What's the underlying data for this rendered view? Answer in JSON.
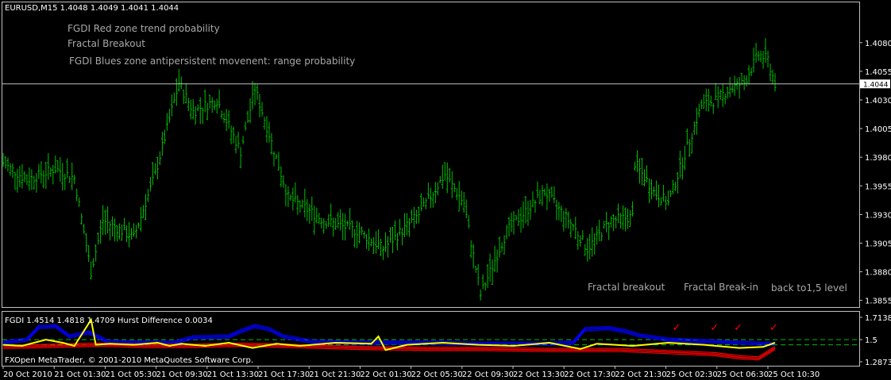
{
  "symbol_header": "EURUSD,M15  1.4048 1.4049 1.4041 1.4044",
  "annotations_top": [
    "FGDI Red zone trend probability",
    "Fractal Breakout",
    "FGDI Blues zone antipersistent movenent: range probability"
  ],
  "annotations_bottom": [
    "Fractal breakout",
    "Fractal Break-in",
    "back to1,5 level"
  ],
  "current_price": "1.4044",
  "indicator_header": "FGDI 1.4514 1.4818 1.4709  Hurst Difference 0.0034",
  "copyright": "FXOpen MetaTrader, © 2001-2010 MetaQuotes Software Corp.",
  "check_mark": "✓",
  "colors": {
    "background": "#000000",
    "bars": "#00c000",
    "frame": "#c0c0c0",
    "fgdi_blue": "#0000ff",
    "fgdi_red": "#ff0000",
    "fgdi_yellow": "#ffff00",
    "level_line": "#00c000",
    "check": "#ff0000"
  },
  "chart_data": [
    {
      "type": "ohlc",
      "title": "EURUSD,M15",
      "ylim": [
        1.3852,
        1.4102
      ],
      "y_ticks": [
        "1.4080",
        "1.4055",
        "1.4030",
        "1.4005",
        "1.3980",
        "1.3955",
        "1.3930",
        "1.3905",
        "1.3880",
        "1.3855"
      ],
      "x_ticks": [
        "20 Oct 2010",
        "21 Oct 01:30",
        "21 Oct 05:30",
        "21 Oct 09:30",
        "21 Oct 13:30",
        "21 Oct 17:30",
        "21 Oct 21:30",
        "22 Oct 01:30",
        "22 Oct 05:30",
        "22 Oct 09:30",
        "22 Oct 13:30",
        "22 Oct 17:30",
        "22 Oct 21:30",
        "25 Oct 02:30",
        "25 Oct 06:30",
        "25 Oct 10:30"
      ],
      "key_points": [
        {
          "bar": 0,
          "price": 1.3975
        },
        {
          "bar": 10,
          "price": 1.396
        },
        {
          "bar": 22,
          "price": 1.397
        },
        {
          "bar": 30,
          "price": 1.3962
        },
        {
          "bar": 37,
          "price": 1.388
        },
        {
          "bar": 42,
          "price": 1.3925
        },
        {
          "bar": 55,
          "price": 1.391
        },
        {
          "bar": 64,
          "price": 1.3965
        },
        {
          "bar": 74,
          "price": 1.4045
        },
        {
          "bar": 80,
          "price": 1.402
        },
        {
          "bar": 90,
          "price": 1.403
        },
        {
          "bar": 100,
          "price": 1.3985
        },
        {
          "bar": 106,
          "price": 1.404
        },
        {
          "bar": 112,
          "price": 1.4
        },
        {
          "bar": 120,
          "price": 1.3945
        },
        {
          "bar": 135,
          "price": 1.3925
        },
        {
          "bar": 150,
          "price": 1.3915
        },
        {
          "bar": 160,
          "price": 1.39
        },
        {
          "bar": 175,
          "price": 1.393
        },
        {
          "bar": 186,
          "price": 1.3965
        },
        {
          "bar": 194,
          "price": 1.394
        },
        {
          "bar": 201,
          "price": 1.386
        },
        {
          "bar": 212,
          "price": 1.3915
        },
        {
          "bar": 228,
          "price": 1.395
        },
        {
          "bar": 240,
          "price": 1.392
        },
        {
          "bar": 246,
          "price": 1.39
        },
        {
          "bar": 256,
          "price": 1.3925
        },
        {
          "bar": 265,
          "price": 1.3928
        },
        {
          "bar": 266,
          "price": 1.3975
        },
        {
          "bar": 274,
          "price": 1.395
        },
        {
          "bar": 280,
          "price": 1.394
        },
        {
          "bar": 294,
          "price": 1.4025
        },
        {
          "bar": 300,
          "price": 1.403
        },
        {
          "bar": 306,
          "price": 1.404
        },
        {
          "bar": 312,
          "price": 1.4045
        },
        {
          "bar": 318,
          "price": 1.407
        },
        {
          "bar": 322,
          "price": 1.4065
        },
        {
          "bar": 325,
          "price": 1.4044
        }
      ]
    },
    {
      "type": "line",
      "title": "FGDI 1.4514 1.4818 1.4709  Hurst Difference 0.0034",
      "ylim": [
        1.2873,
        1.7138
      ],
      "y_ticks": [
        "1.7138",
        "1.5",
        "1.2873"
      ],
      "levels": [
        1.5,
        1.45
      ],
      "series": [
        {
          "name": "FGDI 1.4514",
          "color": "#0000ff",
          "points": [
            [
              0,
              1.47
            ],
            [
              10,
              1.5
            ],
            [
              15,
              1.62
            ],
            [
              22,
              1.63
            ],
            [
              28,
              1.53
            ],
            [
              36,
              1.57
            ],
            [
              44,
              1.48
            ],
            [
              60,
              1.47
            ],
            [
              72,
              1.47
            ],
            [
              80,
              1.52
            ],
            [
              95,
              1.53
            ],
            [
              100,
              1.58
            ],
            [
              106,
              1.63
            ],
            [
              112,
              1.6
            ],
            [
              118,
              1.53
            ],
            [
              130,
              1.48
            ],
            [
              150,
              1.47
            ],
            [
              180,
              1.47
            ],
            [
              200,
              1.46
            ],
            [
              230,
              1.46
            ],
            [
              240,
              1.47
            ],
            [
              245,
              1.6
            ],
            [
              255,
              1.61
            ],
            [
              262,
              1.58
            ],
            [
              268,
              1.54
            ],
            [
              280,
              1.5
            ],
            [
              300,
              1.48
            ],
            [
              320,
              1.46
            ],
            [
              325,
              1.46
            ]
          ]
        },
        {
          "name": "FGDI 1.4818",
          "color": "#ff0000",
          "points": [
            [
              0,
              1.43
            ],
            [
              20,
              1.44
            ],
            [
              40,
              1.45
            ],
            [
              60,
              1.44
            ],
            [
              80,
              1.44
            ],
            [
              100,
              1.45
            ],
            [
              120,
              1.44
            ],
            [
              150,
              1.42
            ],
            [
              180,
              1.41
            ],
            [
              200,
              1.41
            ],
            [
              230,
              1.4
            ],
            [
              260,
              1.4
            ],
            [
              280,
              1.38
            ],
            [
              300,
              1.36
            ],
            [
              310,
              1.33
            ],
            [
              318,
              1.32
            ],
            [
              325,
              1.42
            ]
          ]
        },
        {
          "name": "FGDI 1.4709",
          "color": "#ffff00",
          "points": [
            [
              0,
              1.45
            ],
            [
              8,
              1.44
            ],
            [
              18,
              1.5
            ],
            [
              25,
              1.47
            ],
            [
              30,
              1.44
            ],
            [
              37,
              1.69
            ],
            [
              39,
              1.45
            ],
            [
              45,
              1.46
            ],
            [
              55,
              1.45
            ],
            [
              65,
              1.47
            ],
            [
              70,
              1.44
            ],
            [
              75,
              1.46
            ],
            [
              85,
              1.44
            ],
            [
              95,
              1.47
            ],
            [
              105,
              1.42
            ],
            [
              115,
              1.46
            ],
            [
              125,
              1.44
            ],
            [
              140,
              1.47
            ],
            [
              155,
              1.46
            ],
            [
              158,
              1.53
            ],
            [
              161,
              1.4
            ],
            [
              170,
              1.45
            ],
            [
              185,
              1.47
            ],
            [
              200,
              1.45
            ],
            [
              215,
              1.44
            ],
            [
              230,
              1.47
            ],
            [
              243,
              1.41
            ],
            [
              250,
              1.46
            ],
            [
              265,
              1.44
            ],
            [
              280,
              1.47
            ],
            [
              295,
              1.45
            ],
            [
              310,
              1.42
            ],
            [
              320,
              1.43
            ],
            [
              325,
              1.47
            ]
          ]
        }
      ],
      "markers": [
        {
          "bar": 283
        },
        {
          "bar": 299
        },
        {
          "bar": 309
        },
        {
          "bar": 324
        }
      ]
    }
  ]
}
